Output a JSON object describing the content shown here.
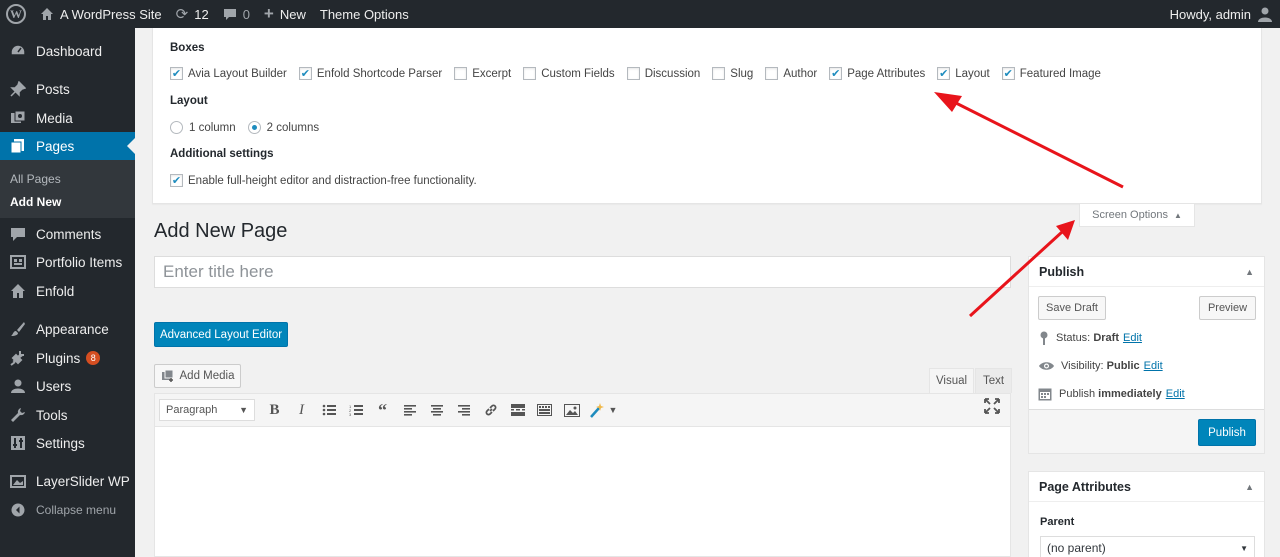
{
  "admin_bar": {
    "site_name": "A WordPress Site",
    "updates_count": "12",
    "comments_count": "0",
    "new_label": "New",
    "theme_options_label": "Theme Options",
    "howdy": "Howdy, admin"
  },
  "sidebar": {
    "items": [
      {
        "label": "Dashboard",
        "icon": "dashboard-icon"
      },
      {
        "label": "Posts",
        "icon": "pin-icon"
      },
      {
        "label": "Media",
        "icon": "media-icon"
      },
      {
        "label": "Pages",
        "icon": "pages-icon",
        "current": true
      },
      {
        "label": "Comments",
        "icon": "comment-icon"
      },
      {
        "label": "Portfolio Items",
        "icon": "portfolio-icon"
      },
      {
        "label": "Enfold",
        "icon": "home-icon"
      },
      {
        "label": "Appearance",
        "icon": "paintbrush-icon"
      },
      {
        "label": "Plugins",
        "icon": "plugin-icon",
        "badge": "8"
      },
      {
        "label": "Users",
        "icon": "users-icon"
      },
      {
        "label": "Tools",
        "icon": "wrench-icon"
      },
      {
        "label": "Settings",
        "icon": "settings-icon"
      },
      {
        "label": "LayerSlider WP",
        "icon": "layerslider-icon"
      }
    ],
    "submenu": {
      "all_pages": "All Pages",
      "add_new": "Add New"
    },
    "collapse_label": "Collapse menu"
  },
  "screen_options": {
    "boxes_heading": "Boxes",
    "boxes": [
      {
        "label": "Avia Layout Builder",
        "checked": true
      },
      {
        "label": "Enfold Shortcode Parser",
        "checked": true
      },
      {
        "label": "Excerpt",
        "checked": false
      },
      {
        "label": "Custom Fields",
        "checked": false
      },
      {
        "label": "Discussion",
        "checked": false
      },
      {
        "label": "Slug",
        "checked": false
      },
      {
        "label": "Author",
        "checked": false
      },
      {
        "label": "Page Attributes",
        "checked": true
      },
      {
        "label": "Layout",
        "checked": true
      },
      {
        "label": "Featured Image",
        "checked": true
      }
    ],
    "layout_heading": "Layout",
    "layout_options": [
      {
        "label": "1 column",
        "selected": false
      },
      {
        "label": "2 columns",
        "selected": true
      }
    ],
    "additional_heading": "Additional settings",
    "additional_option": {
      "label": "Enable full-height editor and distraction-free functionality.",
      "checked": true
    },
    "tab_label": "Screen Options"
  },
  "main": {
    "page_title": "Add New Page",
    "title_placeholder": "Enter title here",
    "ale_button": "Advanced Layout Editor",
    "add_media": "Add Media",
    "tab_visual": "Visual",
    "tab_text": "Text",
    "format_select": "Paragraph",
    "toolbar_icons": [
      "bold-icon",
      "italic-icon",
      "bullet-list-icon",
      "numbered-list-icon",
      "blockquote-icon",
      "align-left-icon",
      "align-center-icon",
      "align-right-icon",
      "link-icon",
      "read-more-icon",
      "toolbar-toggle-icon",
      "image-icon",
      "magic-wand-icon"
    ]
  },
  "publish": {
    "title": "Publish",
    "save_draft": "Save Draft",
    "preview": "Preview",
    "status_label": "Status:",
    "status_value": "Draft",
    "visibility_label": "Visibility:",
    "visibility_value": "Public",
    "publish_label": "Publish",
    "publish_value": "immediately",
    "edit": "Edit",
    "publish_button": "Publish"
  },
  "page_attributes": {
    "title": "Page Attributes",
    "parent_label": "Parent",
    "parent_value": "(no parent)"
  },
  "colors": {
    "admin_dark": "#23282d",
    "accent_blue": "#0073aa",
    "button_blue": "#0085ba",
    "annotation_red": "#e8141b"
  }
}
